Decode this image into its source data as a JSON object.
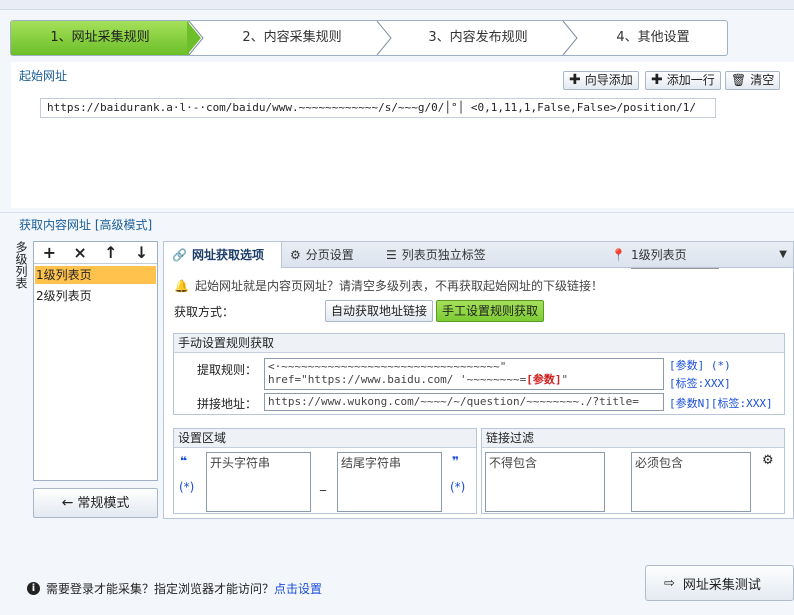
{
  "wizard": {
    "steps": [
      {
        "label": "1、网址采集规则"
      },
      {
        "label": "2、内容采集规则"
      },
      {
        "label": "3、内容发布规则"
      },
      {
        "label": "4、其他设置"
      }
    ]
  },
  "start_url": {
    "section_title": "起始网址",
    "wizard_add_label": "向导添加",
    "add_row_label": "添加一行",
    "clear_label": "清空",
    "url_value": "https://baidurank.a·l·-·com/baidu/www.~~~~~~~~~~~~/s/~~~g/0/│°│ <0,1,11,1,False,False>/position/1/"
  },
  "content_urls": {
    "section_title": "获取内容网址 [高级模式]",
    "multilevel_label": "多级列表",
    "list_tools": [
      "+",
      "×",
      "↑",
      "↓"
    ],
    "list_items": [
      "1级列表页",
      "2级列表页"
    ],
    "selected_index": 0,
    "normal_mode_label": "常规模式"
  },
  "tabs": {
    "items": [
      {
        "label": "网址获取选项"
      },
      {
        "label": "分页设置"
      },
      {
        "label": "列表页独立标签"
      }
    ],
    "level_select": "1级列表页"
  },
  "options": {
    "hint": "起始网址就是内容页网址？请清空多级列表，不再获取起始网址的下级链接！",
    "method_label": "获取方式：",
    "auto_label": "自动获取地址链接",
    "manual_label": "手工设置规则获取",
    "manual_section_title": "手动设置规则获取",
    "extract_rule_label": "提取规则：",
    "extract_rule_line1": "<·~~~~~~~~~~~~~~~~~~~~~~~~~~~~~~~~~\"",
    "extract_rule_line2_prefix": "href=\"https://www.baidu.com/ '~~~~~~~~=",
    "extract_rule_line2_tag": "[参数]",
    "extract_rule_line2_suffix": "\"",
    "extract_params": "[参数]  (*)",
    "extract_tag": "[标签:XXX]",
    "join_url_label": "拼接地址：",
    "join_url_value": "https://www.wukong.com/~~~~/~/question/~~~~~~~~./?title=",
    "join_params": "[参数N][标签:XXX]",
    "settings_area_title": "设置区域",
    "open_quote": "❝",
    "close_quote": "❞",
    "star_left": "(*)",
    "star_right": "(*)",
    "dash": "_",
    "start_string_placeholder": "开头字符串",
    "end_string_placeholder": "结尾字符串",
    "link_filter_title": "链接过滤",
    "must_not_contain_placeholder": "不得包含",
    "must_contain_placeholder": "必须包含"
  },
  "footer": {
    "notice": "需要登录才能采集？指定浏览器才能访问？",
    "notice_link": "点击设置",
    "test_button_label": "网址采集测试"
  },
  "colors": {
    "active_step": "#6cbf29",
    "selected_item": "#ffc34d",
    "manual_button": "#7ccc33",
    "link": "#1a4ed8"
  }
}
